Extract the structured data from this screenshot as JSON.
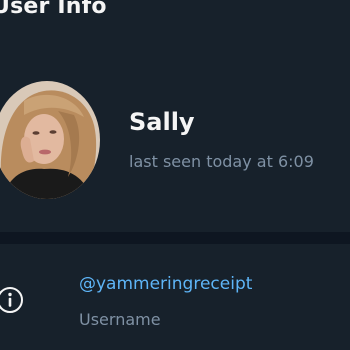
{
  "panel": {
    "title": "User Info"
  },
  "profile": {
    "name": "Sally",
    "status": "last seen today at 6:09",
    "avatar_alt": "profile photo"
  },
  "username_row": {
    "icon": "info-icon",
    "value": "@yammeringreceipt",
    "caption": "Username"
  },
  "colors": {
    "background": "#17212b",
    "divider": "#0e1621",
    "accent": "#5eb5f7",
    "secondary_text": "#7f91a4",
    "primary_text": "#f5f5f5"
  }
}
